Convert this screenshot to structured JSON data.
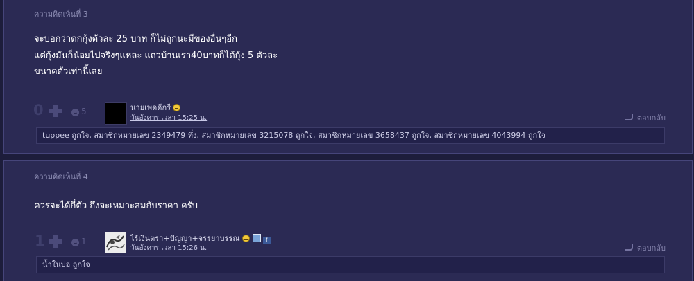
{
  "comments": [
    {
      "title": "ความคิดเห็นที่ 3",
      "body": [
        "จะบอกว่าตกกุ้งตัวละ 25 บาท ก็ไม่ถูกนะมีของอื่นๆอีก",
        "แต่กุ้งมันก็น้อยไปจริงๆแหละ แถวบ้านเรา40บาทก็ได้กุ้ง 5 ตัวละ",
        "ขนาดตัวเท่านี้เลย"
      ],
      "score": "0",
      "feeling_count": "5",
      "author": "นายเพดดีกรี",
      "time": "วันอังคาร เวลา 15:25 น.",
      "reply_label": "ตอบกลับ",
      "emotions": "tuppee ถูกใจ, สมาชิกหมายเลข 2349479 ทึ่ง, สมาชิกหมายเลข 3215078 ถูกใจ, สมาชิกหมายเลข 3658437 ถูกใจ, สมาชิกหมายเลข 4043994 ถูกใจ"
    },
    {
      "title": "ความคิดเห็นที่ 4",
      "body": [
        "ควรจะได้กี่ตัว ถึงจะเหมาะสมกับราคา ครับ"
      ],
      "score": "1",
      "feeling_count": "1",
      "author": "ไร้เงินตรา+ปัญญา+จรรยาบรรณ",
      "time": "วันอังคาร เวลา 15:26 น.",
      "reply_label": "ตอบกลับ",
      "emotions": "น้ำในบ่อ ถูกใจ"
    }
  ],
  "icons": {
    "plus": "plus-icon",
    "feeling": "emotion-icon",
    "reply": "reply-arrow-icon",
    "emoji": "smile-emoji-icon",
    "blog": "blog-badge-icon",
    "facebook": "facebook-badge-icon"
  },
  "colors": {
    "page_bg": "#1d1d3b",
    "card_bg": "#2b2a54",
    "text": "#ffffff",
    "muted": "#8d8db4"
  }
}
